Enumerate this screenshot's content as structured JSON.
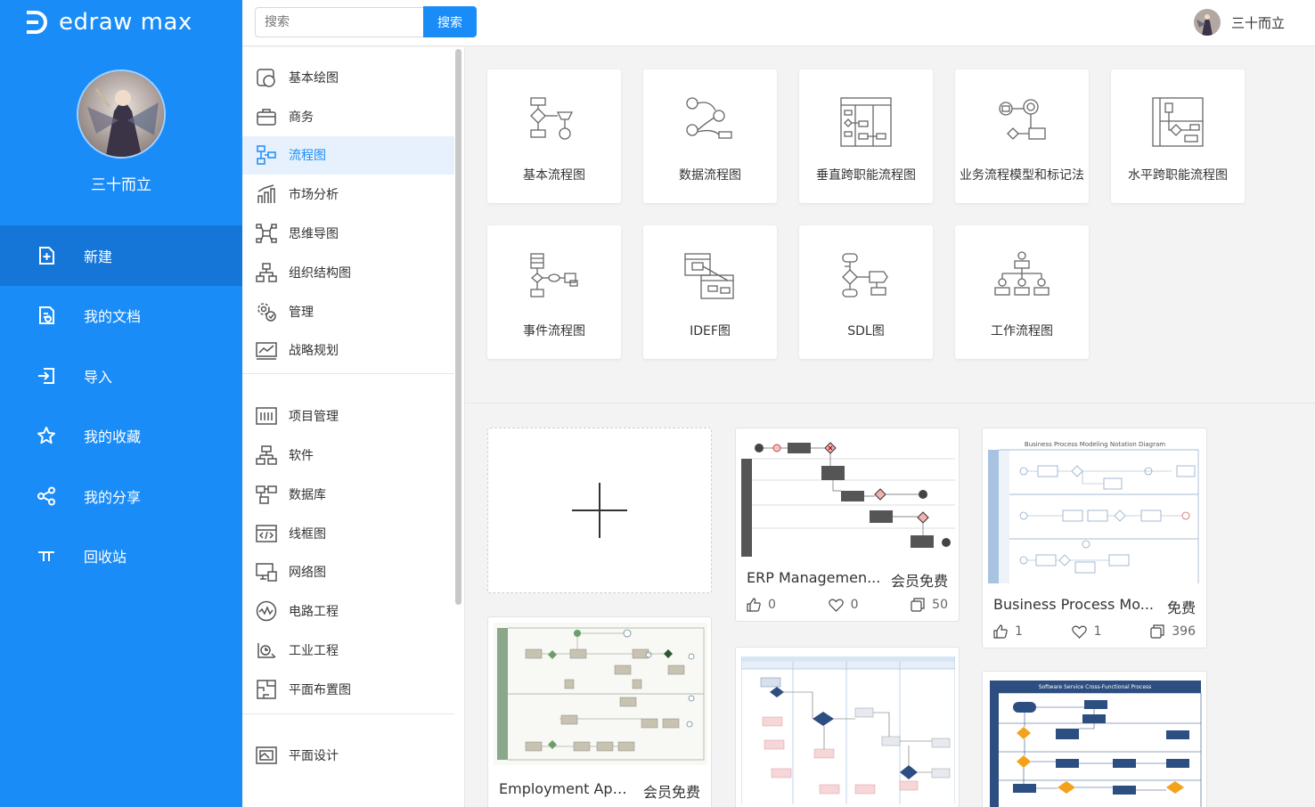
{
  "app": {
    "brand": "edraw max",
    "brand_color": "#1a8cf8"
  },
  "user": {
    "name": "三十而立"
  },
  "sidebar": {
    "items": [
      {
        "label": "新建",
        "icon": "new-file-icon",
        "active": true
      },
      {
        "label": "我的文档",
        "icon": "documents-icon"
      },
      {
        "label": "导入",
        "icon": "import-icon"
      },
      {
        "label": "我的收藏",
        "icon": "star-icon"
      },
      {
        "label": "我的分享",
        "icon": "share-icon"
      },
      {
        "label": "回收站",
        "icon": "trash-icon"
      }
    ]
  },
  "search": {
    "placeholder": "搜索",
    "button": "搜索"
  },
  "categories": {
    "group1": [
      "基本绘图",
      "商务",
      "流程图",
      "市场分析",
      "思维导图",
      "组织结构图",
      "管理",
      "战略规划"
    ],
    "group2": [
      "项目管理",
      "软件",
      "数据库",
      "线框图",
      "网络图",
      "电路工程",
      "工业工程",
      "平面布置图"
    ],
    "group3": [
      "平面设计"
    ],
    "active": "流程图"
  },
  "flow_types": [
    "基本流程图",
    "数据流程图",
    "垂直跨职能流程图",
    "业务流程模型和标记法",
    "水平跨职能流程图",
    "事件流程图",
    "IDEF图",
    "SDL图",
    "工作流程图"
  ],
  "templates": [
    {
      "title": "ERP Managemen...",
      "tag": "会员免费",
      "likes": "0",
      "favorites": "0",
      "copies": "50"
    },
    {
      "title": "Business Process Mo...",
      "tag": "免费",
      "likes": "1",
      "favorites": "1",
      "copies": "396",
      "thumb_title": "Business Process Modeling Notation Diagram"
    },
    {
      "title": "Employment App...",
      "tag": "会员免费"
    },
    {
      "thumb_title": "Software Service Cross-Functional Process"
    }
  ]
}
